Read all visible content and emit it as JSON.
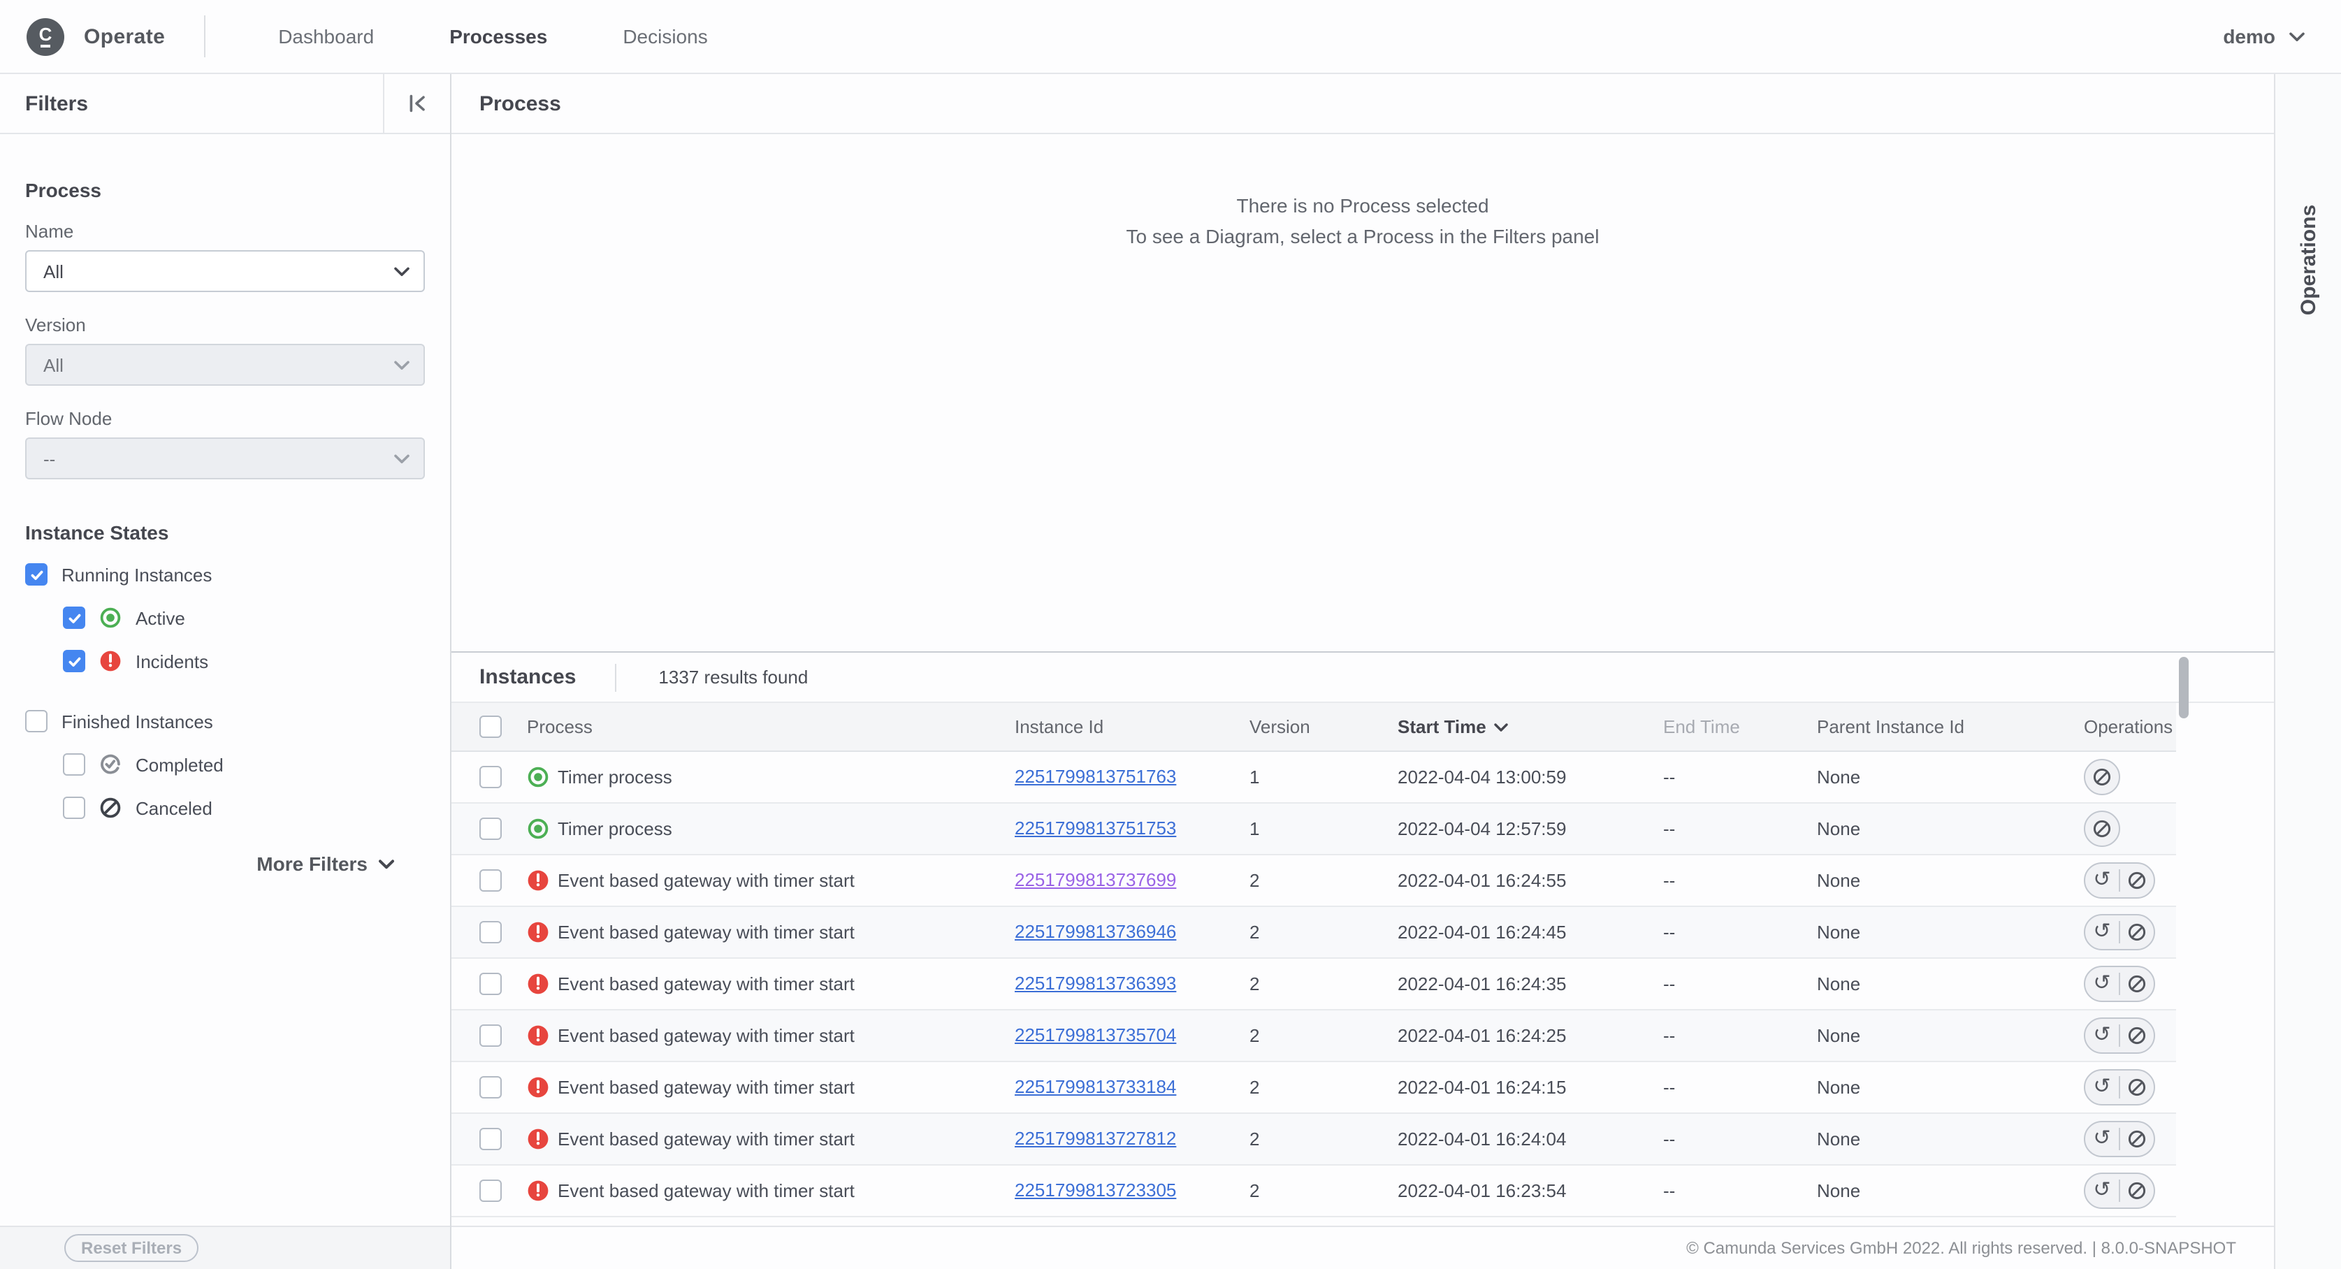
{
  "navbar": {
    "logo_letter": "C",
    "brand": "Operate",
    "items": [
      {
        "label": "Dashboard",
        "active": false
      },
      {
        "label": "Processes",
        "active": true
      },
      {
        "label": "Decisions",
        "active": false
      }
    ],
    "user": "demo"
  },
  "filters_panel": {
    "title": "Filters",
    "process_section_label": "Process",
    "name_label": "Name",
    "name_value": "All",
    "version_label": "Version",
    "version_value": "All",
    "flow_node_label": "Flow Node",
    "flow_node_value": "--",
    "instance_states_label": "Instance States",
    "states": [
      {
        "label": "Running Instances",
        "checked": true,
        "icon": null,
        "indent": false,
        "gap": false
      },
      {
        "label": "Active",
        "checked": true,
        "icon": "active",
        "indent": true,
        "gap": false
      },
      {
        "label": "Incidents",
        "checked": true,
        "icon": "incident",
        "indent": true,
        "gap": false
      },
      {
        "label": "Finished Instances",
        "checked": false,
        "icon": null,
        "indent": false,
        "gap": true
      },
      {
        "label": "Completed",
        "checked": false,
        "icon": "completed",
        "indent": true,
        "gap": false
      },
      {
        "label": "Canceled",
        "checked": false,
        "icon": "canceled",
        "indent": true,
        "gap": false
      }
    ],
    "more_filters_label": "More Filters",
    "reset_button": "Reset Filters"
  },
  "diagram_panel": {
    "title": "Process",
    "empty_title": "There is no Process selected",
    "empty_subtitle": "To see a Diagram, select a Process in the Filters panel"
  },
  "instances_panel": {
    "title": "Instances",
    "results_text": "1337 results found",
    "columns": [
      "Process",
      "Instance Id",
      "Version",
      "Start Time",
      "End Time",
      "Parent Instance Id",
      "Operations"
    ],
    "sorted_column": "Start Time",
    "rows": [
      {
        "state": "active",
        "name": "Timer process",
        "id": "2251799813751763",
        "version": "1",
        "start": "2022-04-04 13:00:59",
        "end": "--",
        "parent": "None",
        "ops": [
          "cancel"
        ],
        "visited": false
      },
      {
        "state": "active",
        "name": "Timer process",
        "id": "2251799813751753",
        "version": "1",
        "start": "2022-04-04 12:57:59",
        "end": "--",
        "parent": "None",
        "ops": [
          "cancel"
        ],
        "visited": false
      },
      {
        "state": "incident",
        "name": "Event based gateway with timer start",
        "id": "2251799813737699",
        "version": "2",
        "start": "2022-04-01 16:24:55",
        "end": "--",
        "parent": "None",
        "ops": [
          "retry",
          "cancel"
        ],
        "visited": true
      },
      {
        "state": "incident",
        "name": "Event based gateway with timer start",
        "id": "2251799813736946",
        "version": "2",
        "start": "2022-04-01 16:24:45",
        "end": "--",
        "parent": "None",
        "ops": [
          "retry",
          "cancel"
        ],
        "visited": false
      },
      {
        "state": "incident",
        "name": "Event based gateway with timer start",
        "id": "2251799813736393",
        "version": "2",
        "start": "2022-04-01 16:24:35",
        "end": "--",
        "parent": "None",
        "ops": [
          "retry",
          "cancel"
        ],
        "visited": false
      },
      {
        "state": "incident",
        "name": "Event based gateway with timer start",
        "id": "2251799813735704",
        "version": "2",
        "start": "2022-04-01 16:24:25",
        "end": "--",
        "parent": "None",
        "ops": [
          "retry",
          "cancel"
        ],
        "visited": false
      },
      {
        "state": "incident",
        "name": "Event based gateway with timer start",
        "id": "2251799813733184",
        "version": "2",
        "start": "2022-04-01 16:24:15",
        "end": "--",
        "parent": "None",
        "ops": [
          "retry",
          "cancel"
        ],
        "visited": false
      },
      {
        "state": "incident",
        "name": "Event based gateway with timer start",
        "id": "2251799813727812",
        "version": "2",
        "start": "2022-04-01 16:24:04",
        "end": "--",
        "parent": "None",
        "ops": [
          "retry",
          "cancel"
        ],
        "visited": false
      },
      {
        "state": "incident",
        "name": "Event based gateway with timer start",
        "id": "2251799813723305",
        "version": "2",
        "start": "2022-04-01 16:23:54",
        "end": "--",
        "parent": "None",
        "ops": [
          "retry",
          "cancel"
        ],
        "visited": false
      }
    ]
  },
  "operations_panel": {
    "title": "Operations"
  },
  "footer": {
    "copyright": "© Camunda Services GmbH 2022. All rights reserved. | 8.0.0-SNAPSHOT"
  },
  "colors": {
    "accent_blue": "#4586f0",
    "active_green": "#4caf54",
    "incident_red": "#e7453e",
    "link_blue": "#3c6fd6",
    "link_visited": "#9a63e6"
  }
}
